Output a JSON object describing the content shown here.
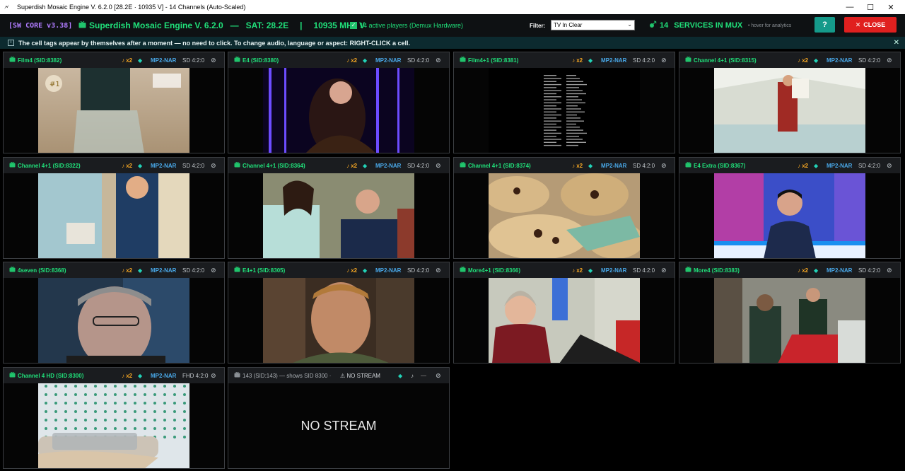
{
  "window": {
    "title": "Superdish Mosaic Engine V. 6.2.0 [28.2E · 10935 V] - 14 Channels (Auto-Scaled)",
    "minimize": "—",
    "maximize": "☐",
    "close": "✕"
  },
  "header": {
    "core": "[SW CORE v3.38]",
    "engine": "Superdish Mosaic Engine V. 6.2.0",
    "sep1": "—",
    "sat": "SAT: 28.2E",
    "sep2": "|",
    "freq": "10935 MHz V",
    "players": "14 active players (Demux Hardware)",
    "filter_label": "Filter:",
    "filter_value": "TV In Clear",
    "services_count": "14",
    "services_label": "SERVICES IN MUX",
    "hover_note": "• hover for analytics",
    "help": "?",
    "close": "CLOSE"
  },
  "info": {
    "text": "The cell tags appear by themselves after a moment — no need to click.   To change audio, language or aspect: RIGHT-CLICK a cell.",
    "close": "✕"
  },
  "cells": [
    {
      "name": "Film4 (SID:8382)",
      "audio": "♪ x2",
      "codec": "MP2-NAR",
      "res": "SD 4:2:0",
      "scene": "film4"
    },
    {
      "name": "E4 (SID:8380)",
      "audio": "♪ x2",
      "codec": "MP2-NAR",
      "res": "SD 4:2:0",
      "scene": "e4"
    },
    {
      "name": "Film4+1 (SID:8381)",
      "audio": "♪ x2",
      "codec": "MP2-NAR",
      "res": "SD 4:2:0",
      "scene": "credits"
    },
    {
      "name": "Channel 4+1 (SID:8315)",
      "audio": "♪ x2",
      "codec": "MP2-NAR",
      "res": "SD 4:2:0",
      "scene": "tent"
    },
    {
      "name": "Channel 4+1 (SID:8322)",
      "audio": "♪ x2",
      "codec": "MP2-NAR",
      "res": "SD 4:2:0",
      "scene": "kitchen"
    },
    {
      "name": "Channel 4+1 (SID:8364)",
      "audio": "♪ x2",
      "codec": "MP2-NAR",
      "res": "SD 4:2:0",
      "scene": "judges"
    },
    {
      "name": "Channel 4+1 (SID:8374)",
      "audio": "♪ x2",
      "codec": "MP2-NAR",
      "res": "SD 4:2:0",
      "scene": "cookies"
    },
    {
      "name": "E4 Extra (SID:8367)",
      "audio": "♪ x2",
      "codec": "MP2-NAR",
      "res": "SD 4:2:0",
      "scene": "host"
    },
    {
      "name": "4seven (SID:8368)",
      "audio": "♪ x2",
      "codec": "MP2-NAR",
      "res": "SD 4:2:0",
      "scene": "oldman"
    },
    {
      "name": "E4+1 (SID:8305)",
      "audio": "♪ x2",
      "codec": "MP2-NAR",
      "res": "SD 4:2:0",
      "scene": "bar"
    },
    {
      "name": "More4+1 (SID:8366)",
      "audio": "♪ x2",
      "codec": "MP2-NAR",
      "res": "SD 4:2:0",
      "scene": "hospital"
    },
    {
      "name": "More4 (SID:8383)",
      "audio": "♪ x2",
      "codec": "MP2-NAR",
      "res": "SD 4:2:0",
      "scene": "paramedic"
    },
    {
      "name": "Channel 4 HD (SID:8300)",
      "audio": "♪ x2",
      "codec": "MP2-NAR",
      "res": "FHD 4:2:0",
      "scene": "gown"
    }
  ],
  "nostream_cell": {
    "name": "143 (SID:143) — shows SID 8300 ·",
    "label": "NO STREAM",
    "note": "♪",
    "dash": "—",
    "body": "NO STREAM"
  }
}
